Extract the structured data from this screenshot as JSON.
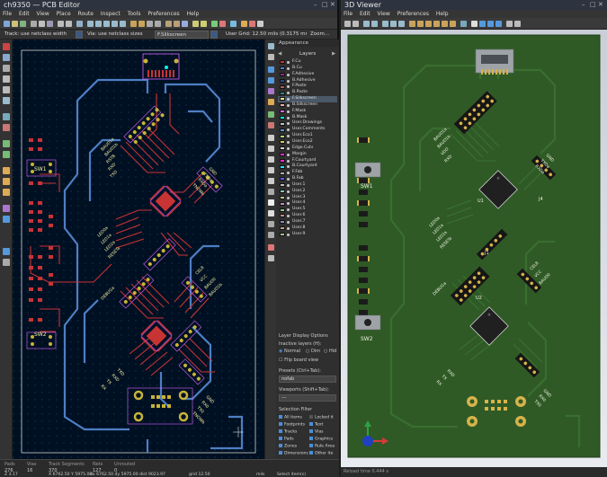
{
  "pcb_editor": {
    "title": "ch9350 — PCB Editor",
    "menu": [
      "File",
      "Edit",
      "View",
      "Place",
      "Route",
      "Inspect",
      "Tools",
      "Preferences",
      "Help"
    ],
    "track_select": "Track: use netclass width",
    "via_select": "Via: use netclass sizes",
    "layer_select": "F.Silkscreen",
    "grid_select": "User Grid: 12.50 mils (0.3175 mm)",
    "zoom_select": "Zoom...",
    "appearance": {
      "title": "Appearance",
      "tab_layers": "Layers",
      "layers": [
        {
          "name": "F.Cu",
          "color": "#c83434"
        },
        {
          "name": "B.Cu",
          "color": "#4d7fc4"
        },
        {
          "name": "F.Adhesive",
          "color": "#8a2b7d"
        },
        {
          "name": "B.Adhesive",
          "color": "#2b4b8a"
        },
        {
          "name": "F.Paste",
          "color": "#b45a5a"
        },
        {
          "name": "B.Paste",
          "color": "#2a8a8a"
        },
        {
          "name": "F.Silkscreen",
          "color": "#f2eda1"
        },
        {
          "name": "B.Silkscreen",
          "color": "#e8b2a7"
        },
        {
          "name": "F.Mask",
          "color": "#d864ff"
        },
        {
          "name": "B.Mask",
          "color": "#02ffee"
        },
        {
          "name": "User.Drawings",
          "color": "#c2c2c2"
        },
        {
          "name": "User.Comments",
          "color": "#5994dc"
        },
        {
          "name": "User.Eco1",
          "color": "#b4db71"
        },
        {
          "name": "User.Eco2",
          "color": "#d8c852"
        },
        {
          "name": "Edge.Cuts",
          "color": "#d0d2cd"
        },
        {
          "name": "Margin",
          "color": "#ff26e2"
        },
        {
          "name": "F.Courtyard",
          "color": "#ff26e2"
        },
        {
          "name": "B.Courtyard",
          "color": "#26e9ff"
        },
        {
          "name": "F.Fab",
          "color": "#afafaf"
        },
        {
          "name": "B.Fab",
          "color": "#585dff"
        },
        {
          "name": "User.1",
          "color": "#c2c2c2"
        },
        {
          "name": "User.2",
          "color": "#89c2c2"
        },
        {
          "name": "User.3",
          "color": "#c2c289"
        },
        {
          "name": "User.4",
          "color": "#c289c2"
        },
        {
          "name": "User.5",
          "color": "#89c289"
        },
        {
          "name": "User.6",
          "color": "#c28989"
        },
        {
          "name": "User.7",
          "color": "#8989c2"
        },
        {
          "name": "User.8",
          "color": "#c2a089"
        },
        {
          "name": "User.9",
          "color": "#a0c289"
        }
      ],
      "layer_display_options": "Layer Display Options",
      "inactive_layers": "Inactive layers (H):",
      "inactive_normal": "Normal",
      "inactive_dim": "Dim",
      "inactive_hide": "Hid",
      "flip_board": "Flip board view",
      "presets_label": "Presets (Ctrl+Tab):",
      "presets_value": "nofab",
      "viewports_label": "Viewports (Shift+Tab):",
      "viewports_value": "---",
      "selection_filter": "Selection Filter",
      "filters": [
        "All items",
        "Locked it",
        "Footprints",
        "Text",
        "Tracks",
        "Vias",
        "Pads",
        "Graphics",
        "Zones",
        "Rule Area",
        "Dimensions",
        "Other ite"
      ]
    },
    "status": {
      "pads_label": "Pads",
      "pads_value": "276",
      "vias_label": "Vias",
      "vias_value": "16",
      "tracks_label": "Track Segments",
      "tracks_value": "370",
      "nets_label": "Nets",
      "nets_value": "127",
      "unrouted_label": "Unrouted",
      "unrouted_value": "0",
      "z": "Z 3.17",
      "xy": "X 6762.50  Y 5975.00",
      "dxy": "dx 6762.50  dy 5975.00  dist 9023.97",
      "grid": "grid 12.50",
      "units": "mils",
      "mode": "Select item(s)"
    },
    "board_labels": {
      "sw1": "SW1",
      "sw2": "SW2",
      "j1": "J1",
      "j2": "J2",
      "j3": "J3",
      "j4": "J4",
      "u1": "U1",
      "u2": "U2",
      "pins_top": [
        "BAUD1a",
        "BAUD1b",
        "RSTB",
        "RXD",
        "TXD",
        "VDD",
        "GND"
      ],
      "pins_right": [
        "GND",
        "TXDa",
        "RXDa",
        "TNOWa"
      ],
      "pins_mid": [
        "LED0a",
        "LED1a",
        "LED2a",
        "RESETa",
        "DEBUGa"
      ],
      "pins_low": [
        "CEL8",
        "VCC",
        "BAUD0",
        "BAUD1b"
      ],
      "pins_bottom": [
        "RX",
        "TX",
        "RXD",
        "TXD",
        "VCC"
      ],
      "pins_br": [
        "GND",
        "RX0",
        "TX0",
        "TNOWb"
      ]
    }
  },
  "viewer_3d": {
    "title": "3D Viewer",
    "menu": [
      "File",
      "Edit",
      "View",
      "Preferences",
      "Help"
    ],
    "status": "Reload time 0.444 s",
    "board_labels": {
      "sw1": "SW1",
      "sw2": "SW2",
      "u1": "U1",
      "u2": "U2",
      "j1": "J1",
      "j4": "J4"
    }
  },
  "colors": {
    "canvas_bg": "#001023",
    "f_cu": "#c83434",
    "b_cu": "#4d7fc4",
    "silk": "#f2eda1",
    "pad": "#c8b438",
    "board_green": "#2f5a26",
    "gold": "#d6b34a",
    "edge": "#d0d2cd"
  }
}
